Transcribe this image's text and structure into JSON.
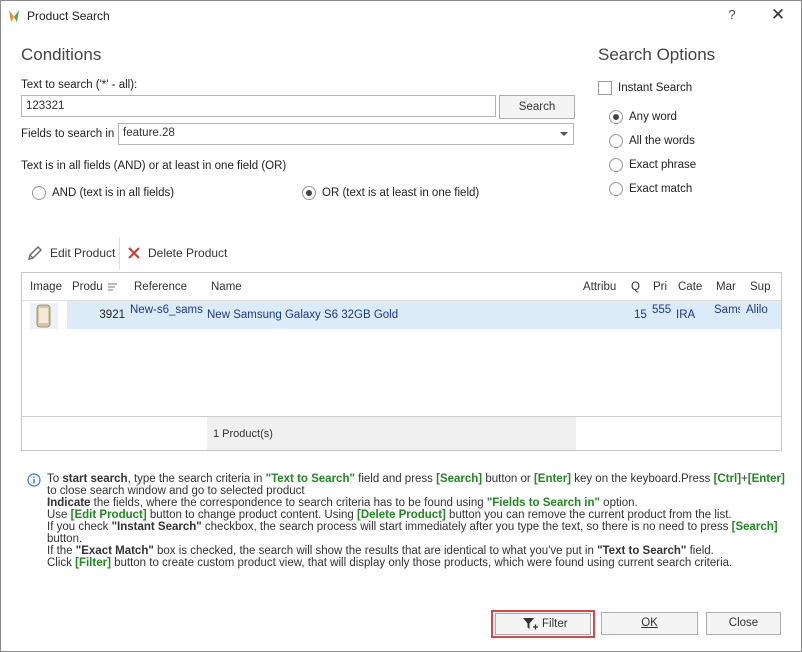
{
  "window": {
    "title": "Product Search",
    "help": "?",
    "close": "✕"
  },
  "conditions": {
    "heading": "Conditions",
    "text_label": "Text to search ('*' - all):",
    "text_value": "123321",
    "search_button": "Search",
    "fields_label": "Fields to search in",
    "fields_value": "feature.28",
    "mode_label": "Text is in all fields (AND) or at least in one field (OR)",
    "and_option": "AND (text is in all fields)",
    "or_option": "OR (text is at least in one field)",
    "selected_mode": "OR"
  },
  "search_options": {
    "heading": "Search Options",
    "instant_search": "Instant Search",
    "instant_checked": false,
    "options": [
      "Any word",
      "All the words",
      "Exact phrase",
      "Exact match"
    ],
    "selected": "Any word"
  },
  "toolbar": {
    "edit": "Edit Product",
    "delete": "Delete Product"
  },
  "grid": {
    "columns": [
      "Image",
      "Produ",
      "Reference",
      "Name",
      "Attribu",
      "Q",
      "Pri",
      "Cate",
      "Mar",
      "Sup"
    ],
    "rows": [
      {
        "id": "3921",
        "reference": "New-s6_sams",
        "name": "New Samsung Galaxy S6 32GB Gold",
        "attributes": "",
        "quantity": "15",
        "price": "555.",
        "category": "IRA",
        "manufacturer": "Sams",
        "supplier": "Alilo"
      }
    ],
    "count_text": "1 Product(s)"
  },
  "info": {
    "l1": [
      "To ",
      "start search",
      ", type the search criteria in ",
      "\"Text to Search\"",
      " field and press ",
      "[Search]",
      " button or ",
      "[Enter]",
      " key on the keyboard.Press ",
      "[Ctrl]",
      "+",
      "[Enter]"
    ],
    "l2": "to close search window and go to selected product",
    "l3": [
      "Indicate",
      " the fields, where the correspondence to search criteria has to be found using ",
      "\"Fields to Search in\"",
      " option."
    ],
    "l4": [
      "Use ",
      "[Edit Product]",
      " button to change product content. Using ",
      "[Delete Product]",
      " button you can remove the current product from the list."
    ],
    "l5": [
      "If you check ",
      "\"Instant Search\"",
      " checkbox, the search process will start immediately after you type the text, so there is no need to press ",
      "[Search]"
    ],
    "l6": "button.",
    "l7": [
      "If the ",
      "\"Exact Match\"",
      " box is checked, the search will show the results that are identical to what you've put in ",
      "\"Text to Search\"",
      " field."
    ],
    "l8": [
      "Click ",
      "[Filter]",
      " button to create custom product view, that will display only those products, which were found using current search criteria."
    ]
  },
  "buttons": {
    "filter": "Filter",
    "ok": "OK",
    "close": "Close"
  },
  "colors": {
    "selected_row": "#dcebf8",
    "highlight": "#e0454a",
    "help_green": "#1f8a1f"
  }
}
